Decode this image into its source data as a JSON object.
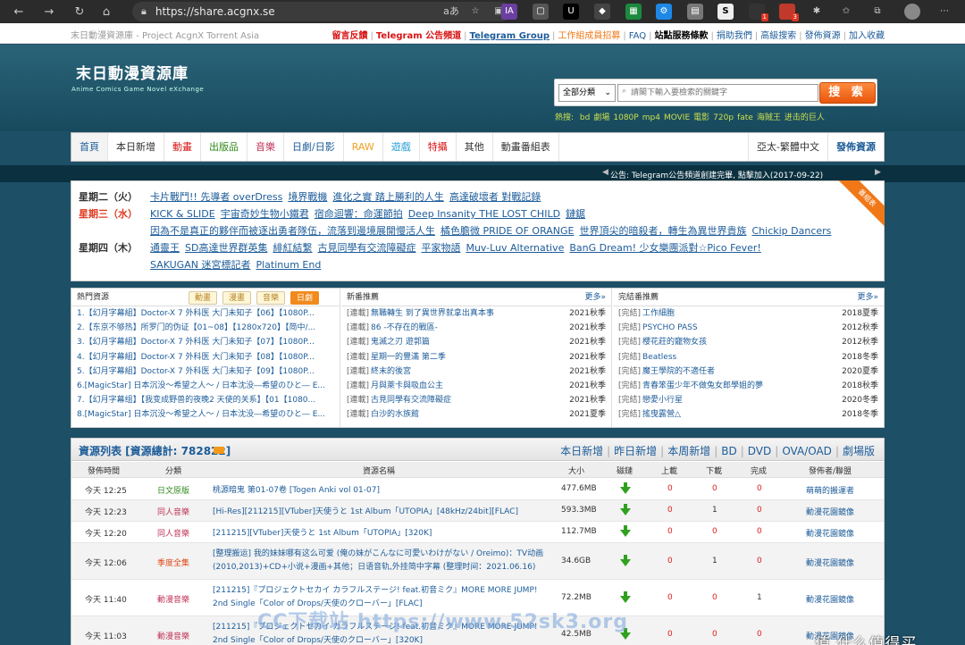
{
  "browser": {
    "url": "https://share.acgnx.se",
    "ext_badge1": "1",
    "ext_badge2": "3"
  },
  "topbar": {
    "site_name": "末日動漫資源庫 - Project AcgnX Torrent Asia",
    "links": [
      {
        "label": "留言反饋",
        "color": "#d81414"
      },
      {
        "label": "Telegram 公告頻道",
        "color": "#d81414"
      },
      {
        "label": "Telegram Group",
        "color": "#1d5c99"
      },
      {
        "label": "工作組成員招募",
        "color": "#f07818"
      },
      {
        "label": "FAQ",
        "color": "#1d5c99"
      },
      {
        "label": "站點服務條款",
        "color": "#000"
      },
      {
        "label": "捐助我們",
        "color": "#1d5c99"
      },
      {
        "label": "高級搜索",
        "color": "#1d5c99"
      },
      {
        "label": "發佈資源",
        "color": "#1d5c99"
      },
      {
        "label": "加入收藏",
        "color": "#1d5c99"
      }
    ]
  },
  "header": {
    "logo_main": "末日動漫資源庫",
    "logo_sub": "Anime Comics Game Novel eXchange",
    "search": {
      "category": "全部分類",
      "placeholder": "請閣下輸入要檢索的關鍵字",
      "button": "搜 索"
    },
    "hot_label": "熱搜:",
    "hot_words": [
      "bd",
      "劇場",
      "1080P",
      "mp4",
      "MOVIE",
      "電影",
      "720p",
      "fate",
      "海賊王",
      "进击的巨人"
    ]
  },
  "nav": {
    "items": [
      {
        "label": "首頁",
        "color": "#1d5c99"
      },
      {
        "label": "本日新增",
        "color": "#333"
      },
      {
        "label": "動畫",
        "color": "#d81414"
      },
      {
        "label": "出版品",
        "color": "#2f8a1a"
      },
      {
        "label": "音樂",
        "color": "#c0355a"
      },
      {
        "label": "日劇/日影",
        "color": "#1d5c99"
      },
      {
        "label": "RAW",
        "color": "#f0a020"
      },
      {
        "label": "遊戲",
        "color": "#2a9fd6"
      },
      {
        "label": "特攝",
        "color": "#d81414"
      },
      {
        "label": "其他",
        "color": "#333"
      },
      {
        "label": "動畫番組表",
        "color": "#333"
      }
    ],
    "region": "亞太-繁體中文",
    "publish": "發佈資源"
  },
  "announcement": "公告: Telegram公告頻道創建完畢, 點擊加入(2017-09-22)",
  "schedule": {
    "ribbon": "番組表",
    "rows": [
      {
        "day": "星期二（火）",
        "today": false,
        "items": [
          "卡片戰鬥!! 先導者 overDress",
          "境界戰機",
          "進化之實 踏上勝利的人生",
          "高達破壞者 對戰記錄"
        ]
      },
      {
        "day": "星期三（水）",
        "today": true,
        "items": [
          "KICK & SLIDE",
          "宇宙奇妙生物小鐵君",
          "宿命迴響：命運節拍",
          "Deep Insanity THE LOST CHILD",
          "鏈鋸"
        ]
      },
      {
        "day": "",
        "today": false,
        "items": [
          "因為不是真正的夥伴而被逐出勇者隊伍，流落到邊境展開慢活人生",
          "橘色膽微 PRIDE OF ORANGE",
          "世界頂尖的暗殺者，轉生為異世界貴族",
          "Chickip Dancers"
        ]
      },
      {
        "day": "星期四（木）",
        "today": false,
        "items": [
          "通靈王",
          "SD高達世界群英集",
          "緋紅結繫",
          "古見同學有交流障礙症",
          "平家物語",
          "Muv-Luv Alternative",
          "BanG Dream! 少女樂團派對☆Pico Fever!"
        ]
      },
      {
        "day": "",
        "today": false,
        "items": [
          "SAKUGAN 迷宮標記者",
          "Platinum End"
        ]
      }
    ]
  },
  "hot_resources": {
    "title": "熱門資源",
    "tabs": [
      {
        "label": "動畫",
        "active": false
      },
      {
        "label": "漫畫",
        "active": false
      },
      {
        "label": "音樂",
        "active": false
      },
      {
        "label": "日劇",
        "active": true
      }
    ],
    "items": [
      "1.【幻月字幕組】Doctor-X 7 外科医 大门未知子【06】【1080P...",
      "2.【东京不够热】所罗门的伪证【01~08】【1280x720】【简中/...",
      "3.【幻月字幕組】Doctor-X 7 外科医 大门未知子【07】【1080P...",
      "4.【幻月字幕組】Doctor-X 7 外科医 大门未知子【08】【1080P...",
      "5.【幻月字幕組】Doctor-X 7 外科医 大门未知子【09】【1080P...",
      "6.[MagicStar] 日本沉没～希望之人～ / 日本沈没―希望のひと― E...",
      "7.【幻月字幕组】【我变成野兽的夜晚2 天使的关系】【01【1080...",
      "8.[MagicStar] 日本沉没～希望之人～ / 日本沈没―希望のひと― E..."
    ]
  },
  "new_recommend": {
    "title": "新番推薦",
    "more": "更多»",
    "items": [
      {
        "label": "[連載]",
        "title": "無職轉生 到了異世界就拿出真本事",
        "season": "2021秋季"
      },
      {
        "label": "[連載]",
        "title": "86 -不存在的戰區-",
        "season": "2021秋季"
      },
      {
        "label": "[連載]",
        "title": "鬼滅之刃 遊郭篇",
        "season": "2021秋季"
      },
      {
        "label": "[連載]",
        "title": "星期一的豐滿 第二季",
        "season": "2021秋季"
      },
      {
        "label": "[連載]",
        "title": "終末的後宮",
        "season": "2021秋季"
      },
      {
        "label": "[連載]",
        "title": "月與萊卡與吸血公主",
        "season": "2021秋季"
      },
      {
        "label": "[連載]",
        "title": "古見同學有交流障礙症",
        "season": "2021秋季"
      },
      {
        "label": "[連載]",
        "title": "白沙的水族館",
        "season": "2021夏季"
      }
    ]
  },
  "finished_recommend": {
    "title": "完結番推薦",
    "more": "更多»",
    "items": [
      {
        "label": "[完結]",
        "title": "工作細胞",
        "season": "2018夏季"
      },
      {
        "label": "[完結]",
        "title": "PSYCHO PASS",
        "season": "2012秋季"
      },
      {
        "label": "[完結]",
        "title": "櫻花莊的寵物女孩",
        "season": "2012秋季"
      },
      {
        "label": "[完結]",
        "title": "Beatless",
        "season": "2018冬季"
      },
      {
        "label": "[完結]",
        "title": "魔王學院的不適任者",
        "season": "2020夏季"
      },
      {
        "label": "[完結]",
        "title": "青春笨蛋少年不做兔女郎學姐的夢",
        "season": "2018秋季"
      },
      {
        "label": "[完結]",
        "title": "戀愛小行星",
        "season": "2020冬季"
      },
      {
        "label": "[完結]",
        "title": "搖曳露營△",
        "season": "2018冬季"
      }
    ]
  },
  "resources": {
    "title": "資源列表 [資源總計: 782822]",
    "links": [
      "本日新增",
      "昨日新增",
      "本周新增",
      "BD",
      "DVD",
      "OVA/OAD",
      "劇場版"
    ],
    "headers": {
      "time": "發佈時間",
      "category": "分類",
      "name": "資源名稱",
      "size": "大小",
      "magnet": "磁鏈",
      "upload": "上載",
      "download": "下載",
      "complete": "完成",
      "publisher": "發佈者/聯盟"
    },
    "rows": [
      {
        "time": "今天 12:25",
        "category": "日文原版",
        "cat_class": "cat-jp",
        "name": "桃源暗鬼 第01-07卷 [Togen Anki vol 01-07]",
        "size": "477.6MB",
        "up": "0",
        "down": "0",
        "complete": "0",
        "publisher": "萌萌的搬運者"
      },
      {
        "time": "今天 12:23",
        "category": "同人音樂",
        "cat_class": "cat-music",
        "name": "[Hi-Res][211215][VTuber]天使うと 1st Album「UTOPIA」[48kHz/24bit][FLAC]",
        "size": "593.3MB",
        "up": "0",
        "down": "1",
        "complete": "0",
        "publisher": "動漫花園鏡像"
      },
      {
        "time": "今天 12:20",
        "category": "同人音樂",
        "cat_class": "cat-music",
        "name": "[211215][VTuber]天使うと 1st Album「UTOPIA」[320K]",
        "size": "112.7MB",
        "up": "0",
        "down": "0",
        "complete": "0",
        "publisher": "動漫花園鏡像"
      },
      {
        "time": "今天 12:06",
        "category": "季度全集",
        "cat_class": "cat-season",
        "name": "[整理搬运] 我的妹妹哪有这么可爱 (俺の妹がこんなに可愛いわけがない / Oreimo)：TV动画(2010,2013)+CD+小说+漫画+其他；日语音轨,外挂简中字幕 (整理时间：2021.06.16)",
        "size": "34.6GB",
        "up": "0",
        "down": "1",
        "complete": "0",
        "publisher": "動漫花園鏡像"
      },
      {
        "time": "今天 11:40",
        "category": "動漫音樂",
        "cat_class": "cat-anime",
        "name": "[211215]『プロジェクトセカイ カラフルステージ! feat.初音ミク』MORE MORE JUMP! 2nd Single「Color of Drops/天使のクローバー」[FLAC]",
        "size": "72.2MB",
        "up": "0",
        "down": "0",
        "complete": "1",
        "publisher": "動漫花園鏡像"
      },
      {
        "time": "今天 11:03",
        "category": "動漫音樂",
        "cat_class": "cat-anime",
        "name": "[211215]『プロジェクトセカイ カラフルステージ! feat.初音ミク』MORE MORE JUMP! 2nd Single「Color of Drops/天使のクローバー」[320K]",
        "size": "42.5MB",
        "up": "0",
        "down": "0",
        "complete": "0",
        "publisher": "動漫花園鏡像"
      }
    ]
  },
  "watermarks": {
    "left": "CC下载站 https://www.52sk3.org",
    "right": "值 什么值得买"
  }
}
